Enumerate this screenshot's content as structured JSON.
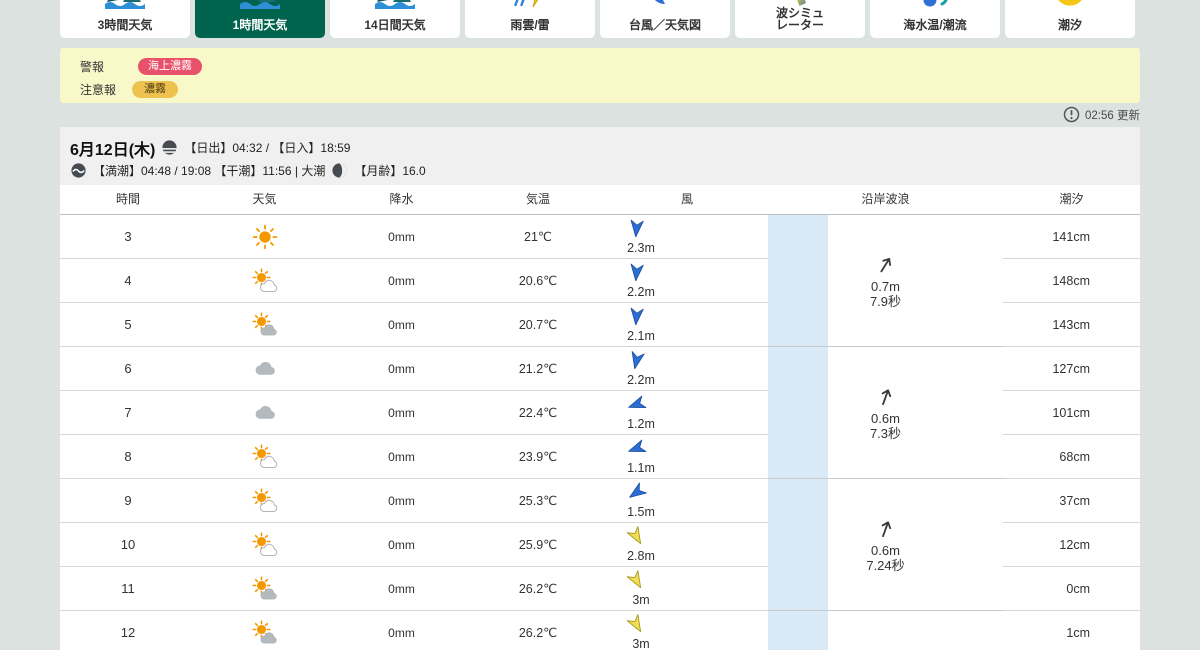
{
  "colors": {
    "page_bg": "#dbe2df",
    "active_tab_green": "#00634e",
    "alert_bg": "#f8f8c9",
    "warning_badge_red": "#e8516a",
    "advisory_badge_yellow": "#eec24f",
    "map_strip_blue": "#d9e9f5",
    "wind_arrow_blue": "#2b6fd6",
    "wind_arrow_yellow": "#f0de52"
  },
  "tabs": [
    {
      "label": "3時間天気",
      "icon": "landscape-icon",
      "active": false
    },
    {
      "label": "1時間天気",
      "icon": "landscape-icon",
      "active": true
    },
    {
      "label": "14日間天気",
      "icon": "landscape-icon",
      "active": false
    },
    {
      "label": "雨雲/雷",
      "icon": "rain-lightning-icon",
      "active": false
    },
    {
      "label": "台風／天気図",
      "icon": "typhoon-icon",
      "active": false
    },
    {
      "label": "波シミュ\nレーター",
      "icon": "wave-sim-icon",
      "active": false
    },
    {
      "label": "海水温/潮流",
      "icon": "sea-temp-icon",
      "active": false
    },
    {
      "label": "潮汐",
      "icon": "tide-circle-icon",
      "active": false
    }
  ],
  "alerts": {
    "warning_label": "警報",
    "warning_badge": "海上濃霧",
    "advisory_label": "注意報",
    "advisory_badge": "濃霧"
  },
  "updated": "02:56 更新",
  "date_band": {
    "date": "6月12日(木)",
    "sun_info": "【日出】04:32 / 【日入】18:59",
    "tide_info": "【満潮】04:48 / 19:08 【干潮】11:56 | 大潮",
    "moon_info": "【月齢】16.0"
  },
  "table": {
    "headers": [
      "時間",
      "天気",
      "降水",
      "気温",
      "風",
      "沿岸波浪",
      "潮汐"
    ],
    "rows": [
      {
        "hour": "3",
        "weather": "sunny",
        "precip": "0mm",
        "temp": "21℃",
        "wind": {
          "dir": 185,
          "color": "blue",
          "speed": "2.3m"
        },
        "tide": "141cm"
      },
      {
        "hour": "4",
        "weather": "sun-cloud",
        "precip": "0mm",
        "temp": "20.6℃",
        "wind": {
          "dir": 185,
          "color": "blue",
          "speed": "2.2m"
        },
        "tide": "148cm"
      },
      {
        "hour": "5",
        "weather": "sun-graycloud",
        "precip": "0mm",
        "temp": "20.7℃",
        "wind": {
          "dir": 185,
          "color": "blue",
          "speed": "2.1m"
        },
        "tide": "143cm"
      },
      {
        "hour": "6",
        "weather": "cloudy",
        "precip": "0mm",
        "temp": "21.2℃",
        "wind": {
          "dir": 192,
          "color": "blue",
          "speed": "2.2m"
        },
        "tide": "127cm"
      },
      {
        "hour": "7",
        "weather": "cloudy",
        "precip": "0mm",
        "temp": "22.4℃",
        "wind": {
          "dir": 250,
          "color": "blue",
          "speed": "1.2m"
        },
        "tide": "101cm"
      },
      {
        "hour": "8",
        "weather": "sun-cloud",
        "precip": "0mm",
        "temp": "23.9℃",
        "wind": {
          "dir": 250,
          "color": "blue",
          "speed": "1.1m"
        },
        "tide": "68cm"
      },
      {
        "hour": "9",
        "weather": "sun-cloud",
        "precip": "0mm",
        "temp": "25.3℃",
        "wind": {
          "dir": 235,
          "color": "blue",
          "speed": "1.5m"
        },
        "tide": "37cm"
      },
      {
        "hour": "10",
        "weather": "sun-cloud",
        "precip": "0mm",
        "temp": "25.9℃",
        "wind": {
          "dir": 150,
          "color": "yellow",
          "speed": "2.8m"
        },
        "tide": "12cm"
      },
      {
        "hour": "11",
        "weather": "sun-graycloud",
        "precip": "0mm",
        "temp": "26.2℃",
        "wind": {
          "dir": 150,
          "color": "yellow",
          "speed": "3m"
        },
        "tide": "0cm"
      },
      {
        "hour": "12",
        "weather": "sun-graycloud",
        "precip": "0mm",
        "temp": "26.2℃",
        "wind": {
          "dir": 150,
          "color": "yellow",
          "speed": "3m"
        },
        "tide": "1cm"
      }
    ],
    "wave_groups": [
      {
        "dir": 32,
        "height": "0.7m",
        "period": "7.9秒"
      },
      {
        "dir": 20,
        "height": "0.6m",
        "period": "7.3秒"
      },
      {
        "dir": 20,
        "height": "0.6m",
        "period": "7.24秒"
      },
      {
        "dir": null,
        "height": "",
        "period": ""
      }
    ]
  }
}
